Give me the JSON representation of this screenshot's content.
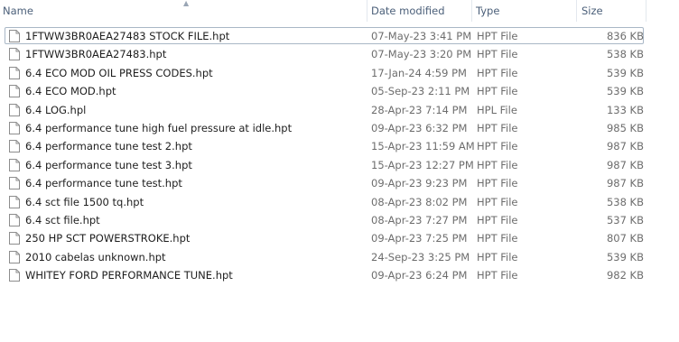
{
  "columns": {
    "name": "Name",
    "date": "Date modified",
    "type": "Type",
    "size": "Size"
  },
  "sort_indicator": "name-ascending",
  "files": [
    {
      "name": "1FTWW3BR0AEA27483 STOCK FILE.hpt",
      "date": "07-May-23 3:41 PM",
      "type": "HPT File",
      "size": "836 KB",
      "selected": true
    },
    {
      "name": "1FTWW3BR0AEA27483.hpt",
      "date": "07-May-23 3:20 PM",
      "type": "HPT File",
      "size": "538 KB"
    },
    {
      "name": "6.4 ECO MOD OIL PRESS CODES.hpt",
      "date": "17-Jan-24 4:59 PM",
      "type": "HPT File",
      "size": "539 KB"
    },
    {
      "name": "6.4 ECO MOD.hpt",
      "date": "05-Sep-23 2:11 PM",
      "type": "HPT File",
      "size": "539 KB"
    },
    {
      "name": "6.4 LOG.hpl",
      "date": "28-Apr-23 7:14 PM",
      "type": "HPL File",
      "size": "133 KB"
    },
    {
      "name": "6.4 performance tune high fuel pressure at idle.hpt",
      "date": "09-Apr-23 6:32 PM",
      "type": "HPT File",
      "size": "985 KB"
    },
    {
      "name": "6.4 performance tune test 2.hpt",
      "date": "15-Apr-23 11:59 AM",
      "type": "HPT File",
      "size": "987 KB"
    },
    {
      "name": "6.4 performance tune test 3.hpt",
      "date": "15-Apr-23 12:27 PM",
      "type": "HPT File",
      "size": "987 KB"
    },
    {
      "name": "6.4 performance tune test.hpt",
      "date": "09-Apr-23 9:23 PM",
      "type": "HPT File",
      "size": "987 KB"
    },
    {
      "name": "6.4 sct file 1500 tq.hpt",
      "date": "08-Apr-23 8:02 PM",
      "type": "HPT File",
      "size": "538 KB"
    },
    {
      "name": "6.4 sct file.hpt",
      "date": "08-Apr-23 7:27 PM",
      "type": "HPT File",
      "size": "537 KB"
    },
    {
      "name": "250 HP SCT POWERSTROKE.hpt",
      "date": "09-Apr-23 7:25 PM",
      "type": "HPT File",
      "size": "807 KB"
    },
    {
      "name": "2010 cabelas unknown.hpt",
      "date": "24-Sep-23 3:25 PM",
      "type": "HPT File",
      "size": "539 KB"
    },
    {
      "name": "WHITEY FORD PERFORMANCE TUNE.hpt",
      "date": "09-Apr-23 6:24 PM",
      "type": "HPT File",
      "size": "982 KB"
    }
  ],
  "colors": {
    "header_text": "#4c607a",
    "name_text": "#1e1e1e",
    "detail_text": "#6d6d6d",
    "focus_border": "#a9b7c6"
  },
  "icons": {
    "file": "document-icon",
    "sort": "sort-ascending-icon"
  }
}
